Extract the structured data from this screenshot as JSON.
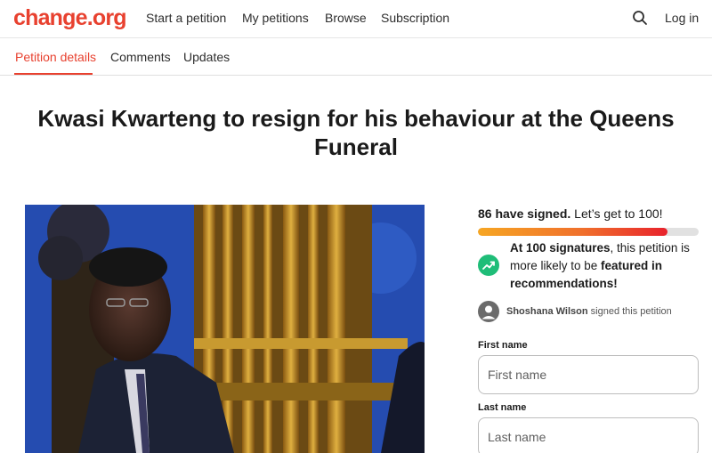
{
  "brand": {
    "logo_text": "change.org",
    "color": "#e8412f"
  },
  "nav": {
    "items": [
      {
        "label": "Start a petition"
      },
      {
        "label": "My petitions"
      },
      {
        "label": "Browse"
      },
      {
        "label": "Subscription"
      }
    ],
    "search_icon": "search-icon",
    "login_label": "Log in"
  },
  "tabs": {
    "items": [
      {
        "label": "Petition details",
        "active": true
      },
      {
        "label": "Comments",
        "active": false
      },
      {
        "label": "Updates",
        "active": false
      }
    ]
  },
  "petition": {
    "title": "Kwasi Kwarteng to resign for his behaviour at the Queens Funeral"
  },
  "signatures": {
    "count_text": "86 have signed.",
    "goal_text": "Let’s get to 100!",
    "progress_fraction": 0.86,
    "milestone": {
      "icon": "trending-up-icon",
      "part1_bold": "At 100 signatures",
      "part2": ", this petition is more likely to be ",
      "part3_bold": "featured in recommendations!"
    }
  },
  "recent_signer": {
    "name": "Shoshana Wilson",
    "action_text": "signed this petition",
    "icon": "avatar-icon"
  },
  "form": {
    "first_name": {
      "label": "First name",
      "placeholder": "First name",
      "value": ""
    },
    "last_name": {
      "label": "Last name",
      "placeholder": "Last name",
      "value": ""
    }
  },
  "colors": {
    "accent": "#e8412f",
    "success": "#1fbd78",
    "progress_start": "#f6a623",
    "progress_end": "#e8222c"
  }
}
